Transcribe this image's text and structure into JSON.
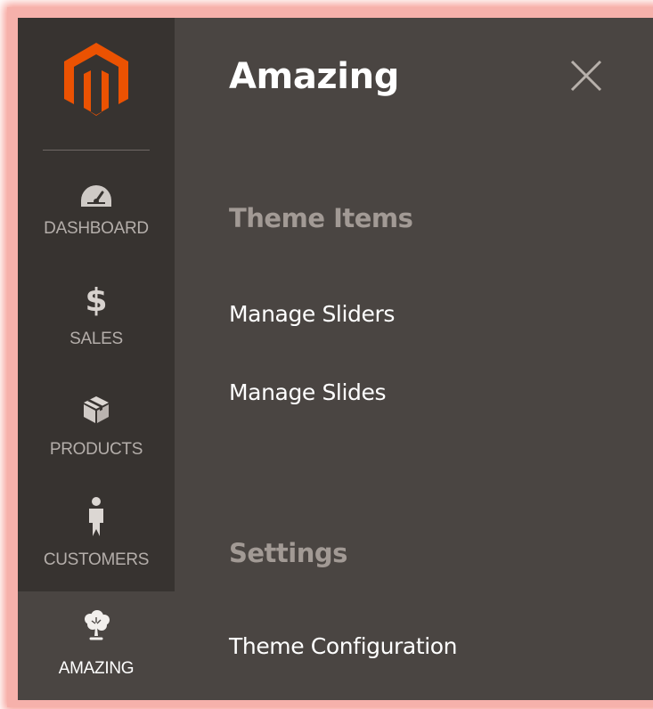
{
  "sidebar": {
    "logo_icon": "magento-logo-icon",
    "items": [
      {
        "label": "DASHBOARD",
        "icon": "gauge-icon"
      },
      {
        "label": "SALES",
        "icon": "dollar-icon",
        "glyph": "$"
      },
      {
        "label": "PRODUCTS",
        "icon": "box-icon"
      },
      {
        "label": "CUSTOMERS",
        "icon": "person-icon"
      },
      {
        "label": "AMAZING",
        "icon": "tree-icon",
        "active": true
      }
    ]
  },
  "panel": {
    "title": "Amazing",
    "close_icon": "close-icon",
    "sections": [
      {
        "title": "Theme Items",
        "links": [
          "Manage Sliders",
          "Manage Slides"
        ]
      },
      {
        "title": "Settings",
        "links": [
          "Theme Configuration"
        ]
      }
    ]
  },
  "colors": {
    "sidebar_bg": "#373330",
    "panel_bg": "#4a4542",
    "accent_logo": "#eb5202",
    "frame_highlight": "#f6b1ab",
    "section_title": "#a29a95",
    "link_text": "#ffffff"
  }
}
